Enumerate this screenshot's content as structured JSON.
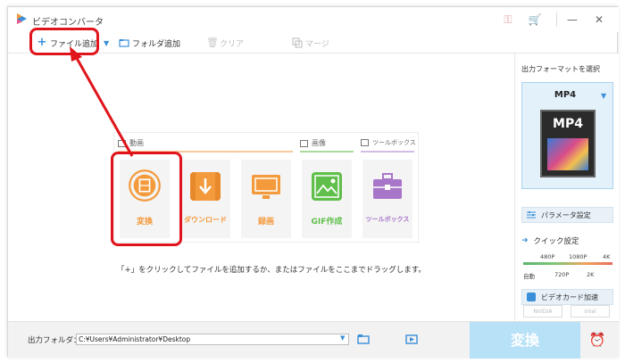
{
  "app": {
    "title": "ビデオコンバータ"
  },
  "toolbar": {
    "add_file": "ファイル追加",
    "add_folder": "フォルダ追加",
    "clear": "クリア",
    "merge": "マージ"
  },
  "sections": {
    "video": "動画",
    "image": "画像",
    "toolbox": "ツールボックス"
  },
  "tiles": [
    {
      "label": "変換",
      "icon": "film-icon"
    },
    {
      "label": "ダウンロード",
      "icon": "download-icon"
    },
    {
      "label": "録画",
      "icon": "screen-record-icon"
    },
    {
      "label": "GIF作成",
      "icon": "image-icon"
    },
    {
      "label": "ツールボックス",
      "icon": "toolbox-icon"
    }
  ],
  "hint": "「+」をクリックしてファイルを追加するか、またはファイルをここまでドラッグします。",
  "right": {
    "output_format_title": "出力フォーマットを選択",
    "format": "MP4",
    "format_icon_text": "MP4",
    "params_button": "パラメータ設定",
    "quick_settings": "クイック設定",
    "slider_top": [
      "480P",
      "1080P",
      "4K"
    ],
    "slider_bottom": [
      "自動",
      "720P",
      "2K"
    ],
    "gpu_accel": "ビデオカード加速",
    "nvidia": "NVIDIA",
    "intel": "Intel"
  },
  "bottom": {
    "output_folder_label": "出力フォルダ：",
    "output_folder_path": "C:¥Users¥Administrator¥Desktop",
    "convert_button": "変換"
  },
  "colors": {
    "accent_blue": "#3a8fd8",
    "annotation_red": "#e0141b",
    "convert_disabled": "#b7e1f7",
    "tile_orange": "#f39a3c",
    "tile_green": "#5fbf4a",
    "tile_purple": "#a776c9"
  }
}
